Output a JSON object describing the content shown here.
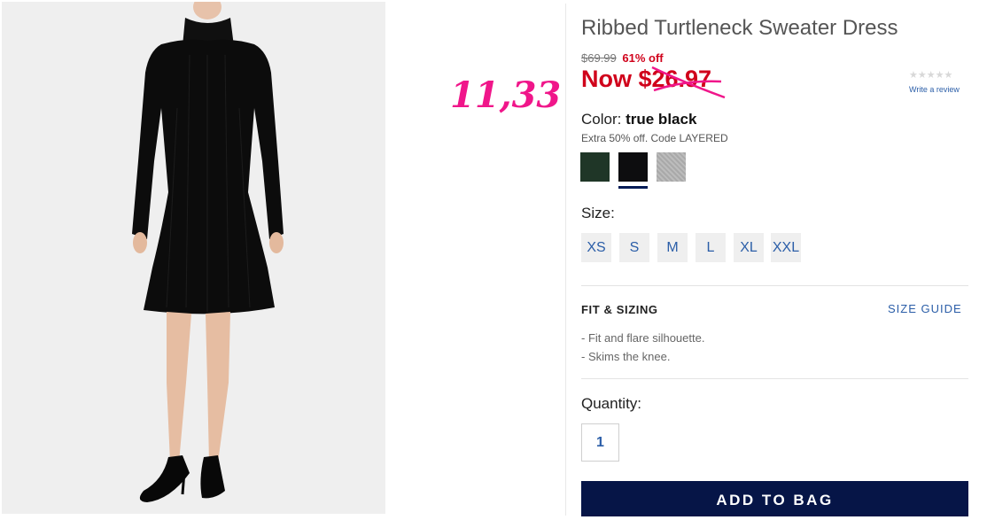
{
  "product": {
    "title": "Ribbed Turtleneck Sweater Dress",
    "old_price": "$69.99",
    "discount": "61% off",
    "now_price": "Now $26.97"
  },
  "annotation": "11,33",
  "rating": {
    "stars": "★★★★★",
    "review_link": "Write a review"
  },
  "color": {
    "label": "Color:",
    "selected": "true black",
    "promo": "Extra 50% off. Code LAYERED",
    "swatches": [
      "#1f3627",
      "#0d0d0f",
      "#b2b2b2"
    ]
  },
  "size": {
    "label": "Size:",
    "options": [
      "XS",
      "S",
      "M",
      "L",
      "XL",
      "XXL"
    ]
  },
  "fit": {
    "title": "FIT & SIZING",
    "size_guide": "SIZE GUIDE",
    "bullets": [
      "- Fit and flare silhouette.",
      "- Skims the knee."
    ]
  },
  "quantity": {
    "label": "Quantity:",
    "value": "1"
  },
  "cta": {
    "add_to_bag": "ADD TO BAG"
  },
  "colors": {
    "sale_red": "#d0021b",
    "link_blue": "#2b5ea8",
    "button_navy": "#061547",
    "annotation_pink": "#f0168a"
  }
}
